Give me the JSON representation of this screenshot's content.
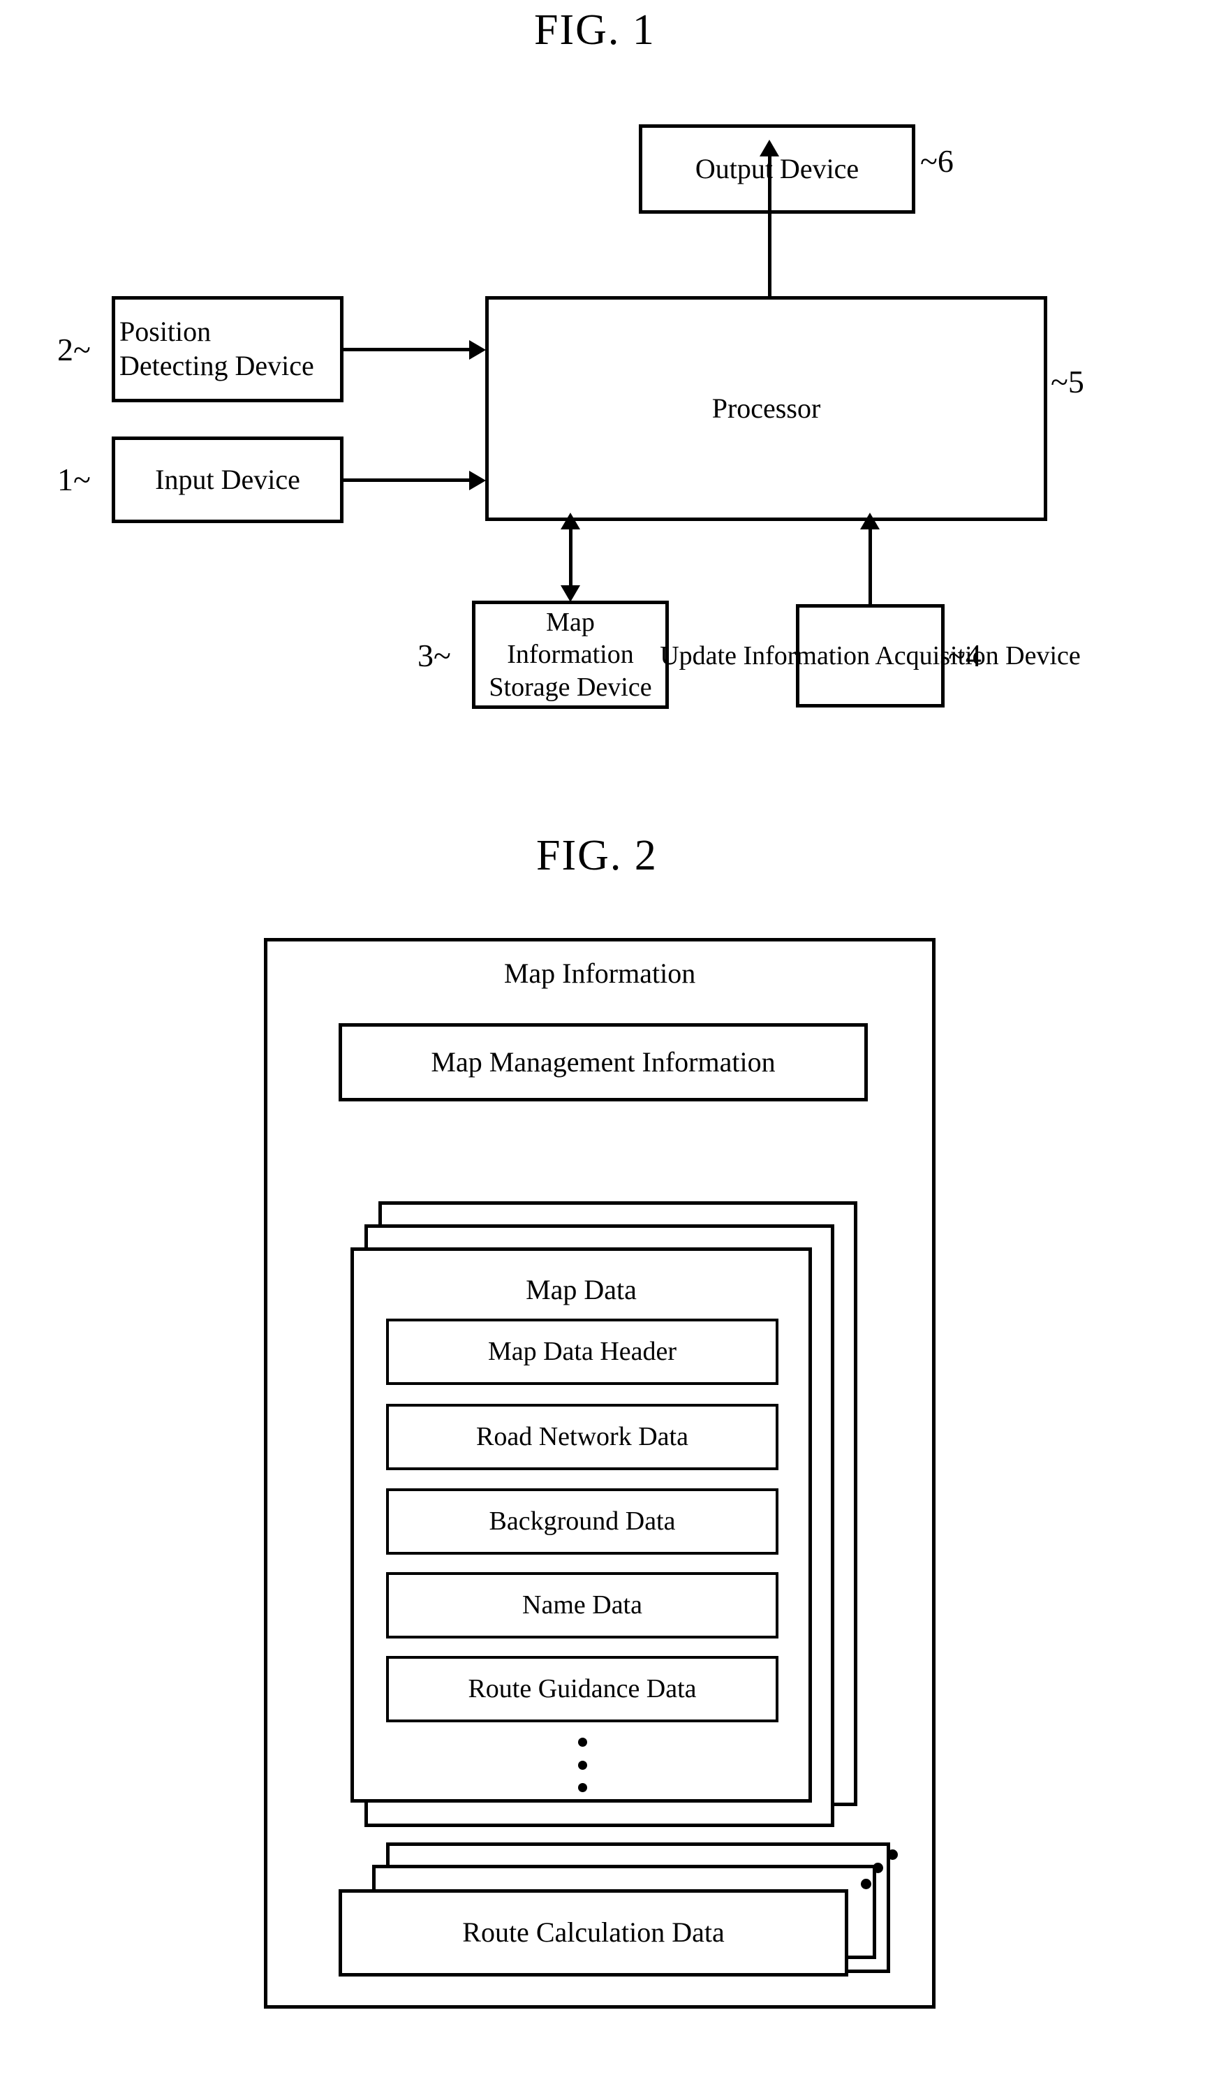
{
  "figures": [
    {
      "title": "FIG. 1",
      "boxes": {
        "output_device": "Output Device",
        "position_detecting_device": "Position\nDetecting Device",
        "input_device": "Input Device",
        "processor": "Processor",
        "map_information_storage_device": "Map Information\nStorage Device",
        "update_information_acquisition_device": "Update Information\nAcquisition Device"
      },
      "reference_numerals": {
        "output_device": "~6",
        "position_detecting_device": "2~",
        "input_device": "1~",
        "processor": "~5",
        "map_information_storage_device": "3~",
        "update_information_acquisition_device": "~4"
      }
    },
    {
      "title": "FIG. 2",
      "outer_label": "Map Information",
      "map_management_information": "Map Management Information",
      "map_data_label": "Map Data",
      "map_data_items": [
        "Map Data Header",
        "Road Network Data",
        "Background Data",
        "Name Data",
        "Route Guidance Data"
      ],
      "route_calculation_data": "Route Calculation Data"
    }
  ],
  "colors": {
    "ink": "#000000",
    "paper": "#ffffff"
  }
}
